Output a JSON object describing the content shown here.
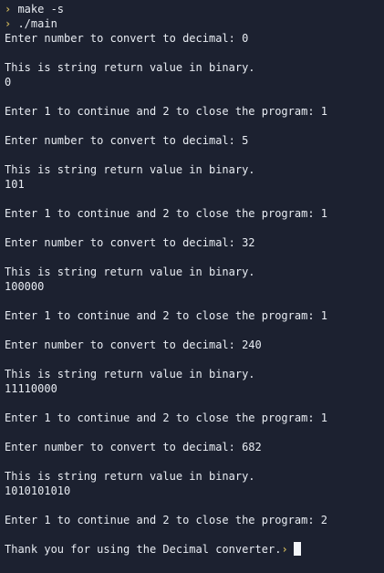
{
  "colors": {
    "background": "#1c2130",
    "text": "#e8ecf2",
    "prompt": "#c9b25a"
  },
  "prompt_icon": "chevron-right-icon",
  "prompt_symbol": "›",
  "lines": [
    {
      "prompt": true,
      "text": " make -s"
    },
    {
      "prompt": true,
      "text": " ./main"
    },
    {
      "text": "Enter number to convert to decimal: 0"
    },
    {
      "text": ""
    },
    {
      "text": "This is string return value in binary."
    },
    {
      "text": "0"
    },
    {
      "text": ""
    },
    {
      "text": "Enter 1 to continue and 2 to close the program: 1"
    },
    {
      "text": ""
    },
    {
      "text": "Enter number to convert to decimal: 5"
    },
    {
      "text": ""
    },
    {
      "text": "This is string return value in binary."
    },
    {
      "text": "101"
    },
    {
      "text": ""
    },
    {
      "text": "Enter 1 to continue and 2 to close the program: 1"
    },
    {
      "text": ""
    },
    {
      "text": "Enter number to convert to decimal: 32"
    },
    {
      "text": ""
    },
    {
      "text": "This is string return value in binary."
    },
    {
      "text": "100000"
    },
    {
      "text": ""
    },
    {
      "text": "Enter 1 to continue and 2 to close the program: 1"
    },
    {
      "text": ""
    },
    {
      "text": "Enter number to convert to decimal: 240"
    },
    {
      "text": ""
    },
    {
      "text": "This is string return value in binary."
    },
    {
      "text": "11110000"
    },
    {
      "text": ""
    },
    {
      "text": "Enter 1 to continue and 2 to close the program: 1"
    },
    {
      "text": ""
    },
    {
      "text": "Enter number to convert to decimal: 682"
    },
    {
      "text": ""
    },
    {
      "text": "This is string return value in binary."
    },
    {
      "text": "1010101010"
    },
    {
      "text": ""
    },
    {
      "text": "Enter 1 to continue and 2 to close the program: 2"
    },
    {
      "text": ""
    },
    {
      "text": "Thank you for using the Decimal converter.",
      "trailing_prompt": true,
      "cursor": true
    }
  ]
}
